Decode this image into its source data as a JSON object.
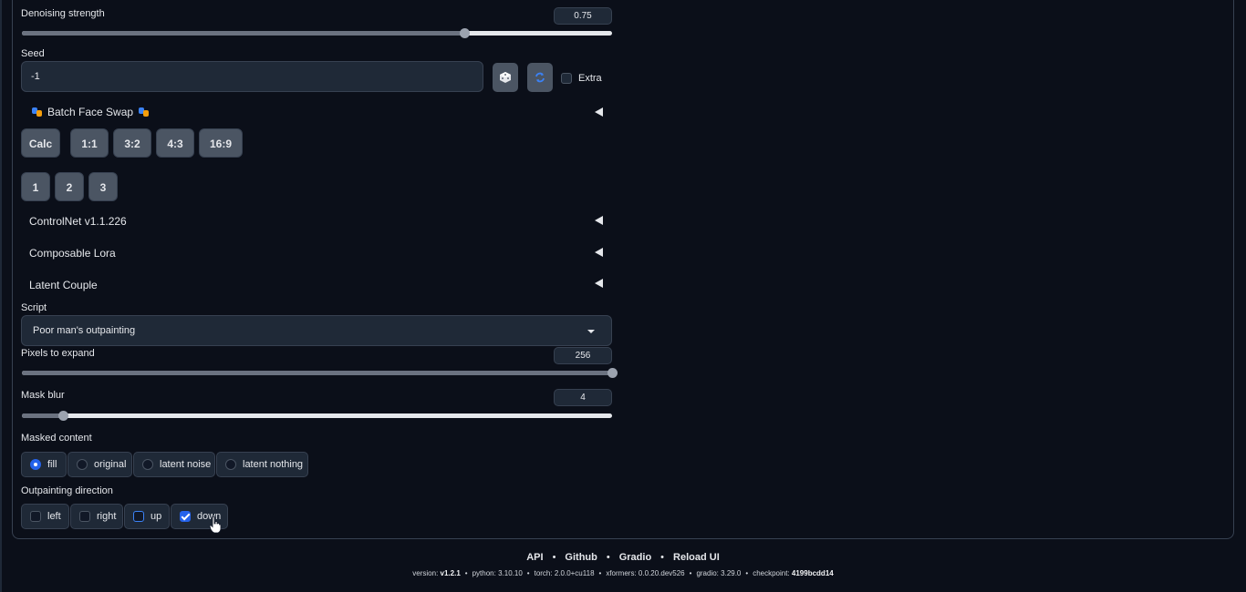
{
  "denoising": {
    "label": "Denoising strength",
    "value": "0.75",
    "fraction": 0.75
  },
  "seed": {
    "label": "Seed",
    "value": "-1",
    "extra_label": "Extra"
  },
  "icons": {
    "random_seed": "dice-icon",
    "reuse_seed": "recycle-icon",
    "batch_face_swap": "theater-masks-icon",
    "cursor": "hand-pointer-icon"
  },
  "batch_face_swap": {
    "label": "Batch Face Swap"
  },
  "ratio_buttons": [
    "Calc",
    "1:1",
    "3:2",
    "4:3",
    "16:9"
  ],
  "number_buttons": [
    "1",
    "2",
    "3"
  ],
  "accordions": [
    "ControlNet v1.1.226",
    "Composable Lora",
    "Latent Couple"
  ],
  "script": {
    "label": "Script",
    "value": "Poor man's outpainting"
  },
  "pixels": {
    "label": "Pixels to expand",
    "value": "256",
    "fraction": 1.0
  },
  "mask_blur": {
    "label": "Mask blur",
    "value": "4",
    "fraction": 0.07
  },
  "masked_content": {
    "label": "Masked content",
    "options": [
      "fill",
      "original",
      "latent noise",
      "latent nothing"
    ],
    "selected": "fill"
  },
  "outpainting_direction": {
    "label": "Outpainting direction",
    "options": [
      "left",
      "right",
      "up",
      "down"
    ],
    "checked": [
      "down"
    ]
  },
  "footer": {
    "links": [
      "API",
      "Github",
      "Gradio",
      "Reload UI"
    ],
    "version_label": "version:",
    "version": "v1.2.1",
    "python_label": "python:",
    "python": "3.10.10",
    "torch_label": "torch:",
    "torch": "2.0.0+cu118",
    "xformers_label": "xformers:",
    "xformers": "0.0.20.dev526",
    "gradio_label": "gradio:",
    "gradio": "3.29.0",
    "checkpoint_label": "checkpoint:",
    "checkpoint": "4199bcdd14"
  },
  "colors": {
    "background": "#0b0f19",
    "accent": "#2563eb",
    "button": "#4b5563"
  }
}
